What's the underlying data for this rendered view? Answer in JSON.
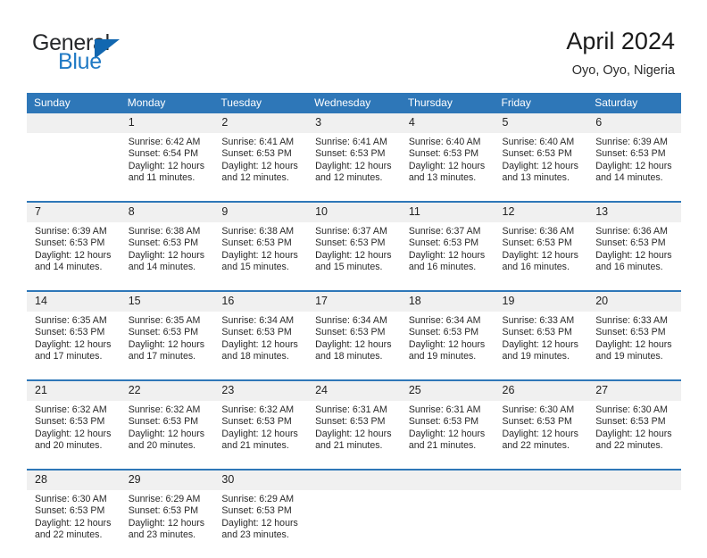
{
  "brand": {
    "name_part1": "General",
    "name_part2": "Blue",
    "accent_color": "#1267b0",
    "triangle_icon": "triangle-icon"
  },
  "header": {
    "title": "April 2024",
    "subtitle": "Oyo, Oyo, Nigeria",
    "header_bg_color": "#2e77b8",
    "daynum_bg_color": "#f0f0f0"
  },
  "weekday_headers": [
    "Sunday",
    "Monday",
    "Tuesday",
    "Wednesday",
    "Thursday",
    "Friday",
    "Saturday"
  ],
  "labels": {
    "sunrise": "Sunrise:",
    "sunset": "Sunset:",
    "daylight": "Daylight:"
  },
  "weeks": [
    [
      {
        "day": "",
        "l1": "",
        "l2": "",
        "l3": "",
        "l4": ""
      },
      {
        "day": "1",
        "l1": "Sunrise: 6:42 AM",
        "l2": "Sunset: 6:54 PM",
        "l3": "Daylight: 12 hours",
        "l4": "and 11 minutes."
      },
      {
        "day": "2",
        "l1": "Sunrise: 6:41 AM",
        "l2": "Sunset: 6:53 PM",
        "l3": "Daylight: 12 hours",
        "l4": "and 12 minutes."
      },
      {
        "day": "3",
        "l1": "Sunrise: 6:41 AM",
        "l2": "Sunset: 6:53 PM",
        "l3": "Daylight: 12 hours",
        "l4": "and 12 minutes."
      },
      {
        "day": "4",
        "l1": "Sunrise: 6:40 AM",
        "l2": "Sunset: 6:53 PM",
        "l3": "Daylight: 12 hours",
        "l4": "and 13 minutes."
      },
      {
        "day": "5",
        "l1": "Sunrise: 6:40 AM",
        "l2": "Sunset: 6:53 PM",
        "l3": "Daylight: 12 hours",
        "l4": "and 13 minutes."
      },
      {
        "day": "6",
        "l1": "Sunrise: 6:39 AM",
        "l2": "Sunset: 6:53 PM",
        "l3": "Daylight: 12 hours",
        "l4": "and 14 minutes."
      }
    ],
    [
      {
        "day": "7",
        "l1": "Sunrise: 6:39 AM",
        "l2": "Sunset: 6:53 PM",
        "l3": "Daylight: 12 hours",
        "l4": "and 14 minutes."
      },
      {
        "day": "8",
        "l1": "Sunrise: 6:38 AM",
        "l2": "Sunset: 6:53 PM",
        "l3": "Daylight: 12 hours",
        "l4": "and 14 minutes."
      },
      {
        "day": "9",
        "l1": "Sunrise: 6:38 AM",
        "l2": "Sunset: 6:53 PM",
        "l3": "Daylight: 12 hours",
        "l4": "and 15 minutes."
      },
      {
        "day": "10",
        "l1": "Sunrise: 6:37 AM",
        "l2": "Sunset: 6:53 PM",
        "l3": "Daylight: 12 hours",
        "l4": "and 15 minutes."
      },
      {
        "day": "11",
        "l1": "Sunrise: 6:37 AM",
        "l2": "Sunset: 6:53 PM",
        "l3": "Daylight: 12 hours",
        "l4": "and 16 minutes."
      },
      {
        "day": "12",
        "l1": "Sunrise: 6:36 AM",
        "l2": "Sunset: 6:53 PM",
        "l3": "Daylight: 12 hours",
        "l4": "and 16 minutes."
      },
      {
        "day": "13",
        "l1": "Sunrise: 6:36 AM",
        "l2": "Sunset: 6:53 PM",
        "l3": "Daylight: 12 hours",
        "l4": "and 16 minutes."
      }
    ],
    [
      {
        "day": "14",
        "l1": "Sunrise: 6:35 AM",
        "l2": "Sunset: 6:53 PM",
        "l3": "Daylight: 12 hours",
        "l4": "and 17 minutes."
      },
      {
        "day": "15",
        "l1": "Sunrise: 6:35 AM",
        "l2": "Sunset: 6:53 PM",
        "l3": "Daylight: 12 hours",
        "l4": "and 17 minutes."
      },
      {
        "day": "16",
        "l1": "Sunrise: 6:34 AM",
        "l2": "Sunset: 6:53 PM",
        "l3": "Daylight: 12 hours",
        "l4": "and 18 minutes."
      },
      {
        "day": "17",
        "l1": "Sunrise: 6:34 AM",
        "l2": "Sunset: 6:53 PM",
        "l3": "Daylight: 12 hours",
        "l4": "and 18 minutes."
      },
      {
        "day": "18",
        "l1": "Sunrise: 6:34 AM",
        "l2": "Sunset: 6:53 PM",
        "l3": "Daylight: 12 hours",
        "l4": "and 19 minutes."
      },
      {
        "day": "19",
        "l1": "Sunrise: 6:33 AM",
        "l2": "Sunset: 6:53 PM",
        "l3": "Daylight: 12 hours",
        "l4": "and 19 minutes."
      },
      {
        "day": "20",
        "l1": "Sunrise: 6:33 AM",
        "l2": "Sunset: 6:53 PM",
        "l3": "Daylight: 12 hours",
        "l4": "and 19 minutes."
      }
    ],
    [
      {
        "day": "21",
        "l1": "Sunrise: 6:32 AM",
        "l2": "Sunset: 6:53 PM",
        "l3": "Daylight: 12 hours",
        "l4": "and 20 minutes."
      },
      {
        "day": "22",
        "l1": "Sunrise: 6:32 AM",
        "l2": "Sunset: 6:53 PM",
        "l3": "Daylight: 12 hours",
        "l4": "and 20 minutes."
      },
      {
        "day": "23",
        "l1": "Sunrise: 6:32 AM",
        "l2": "Sunset: 6:53 PM",
        "l3": "Daylight: 12 hours",
        "l4": "and 21 minutes."
      },
      {
        "day": "24",
        "l1": "Sunrise: 6:31 AM",
        "l2": "Sunset: 6:53 PM",
        "l3": "Daylight: 12 hours",
        "l4": "and 21 minutes."
      },
      {
        "day": "25",
        "l1": "Sunrise: 6:31 AM",
        "l2": "Sunset: 6:53 PM",
        "l3": "Daylight: 12 hours",
        "l4": "and 21 minutes."
      },
      {
        "day": "26",
        "l1": "Sunrise: 6:30 AM",
        "l2": "Sunset: 6:53 PM",
        "l3": "Daylight: 12 hours",
        "l4": "and 22 minutes."
      },
      {
        "day": "27",
        "l1": "Sunrise: 6:30 AM",
        "l2": "Sunset: 6:53 PM",
        "l3": "Daylight: 12 hours",
        "l4": "and 22 minutes."
      }
    ],
    [
      {
        "day": "28",
        "l1": "Sunrise: 6:30 AM",
        "l2": "Sunset: 6:53 PM",
        "l3": "Daylight: 12 hours",
        "l4": "and 22 minutes."
      },
      {
        "day": "29",
        "l1": "Sunrise: 6:29 AM",
        "l2": "Sunset: 6:53 PM",
        "l3": "Daylight: 12 hours",
        "l4": "and 23 minutes."
      },
      {
        "day": "30",
        "l1": "Sunrise: 6:29 AM",
        "l2": "Sunset: 6:53 PM",
        "l3": "Daylight: 12 hours",
        "l4": "and 23 minutes."
      },
      {
        "day": "",
        "l1": "",
        "l2": "",
        "l3": "",
        "l4": ""
      },
      {
        "day": "",
        "l1": "",
        "l2": "",
        "l3": "",
        "l4": ""
      },
      {
        "day": "",
        "l1": "",
        "l2": "",
        "l3": "",
        "l4": ""
      },
      {
        "day": "",
        "l1": "",
        "l2": "",
        "l3": "",
        "l4": ""
      }
    ]
  ]
}
